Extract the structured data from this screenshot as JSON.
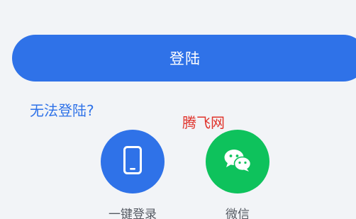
{
  "login": {
    "button_label": "登陆",
    "cannot_login_label": "无法登陆?"
  },
  "watermark": "腾飞网",
  "options": [
    {
      "label": "一键登录",
      "icon": "phone-icon",
      "color": "#2f72e8"
    },
    {
      "label": "微信",
      "icon": "wechat-icon",
      "color": "#0ec25c"
    }
  ],
  "colors": {
    "accent": "#2f72e8",
    "wechat": "#0ec25c",
    "background": "#f2f4f7",
    "watermark": "#e0332b"
  }
}
